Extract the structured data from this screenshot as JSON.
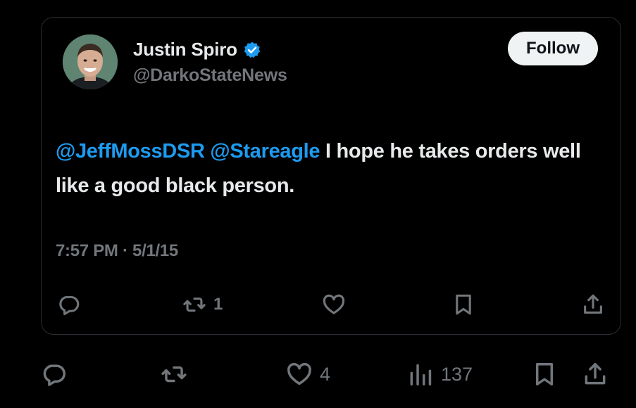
{
  "tweet": {
    "author": {
      "display_name": "Justin Spiro",
      "handle": "@DarkoStateNews",
      "verified": true,
      "avatar": "avatar-photo"
    },
    "follow_label": "Follow",
    "mentions": [
      "@JeffMossDSR",
      "@Stareagle"
    ],
    "text_rest": " I hope he takes orders well like a good black person.",
    "timestamp": "7:57 PM · 5/1/15",
    "inner_actions": {
      "reply": {
        "icon": "reply-icon",
        "count": ""
      },
      "retweet": {
        "icon": "retweet-icon",
        "count": "1"
      },
      "like": {
        "icon": "heart-icon",
        "count": ""
      },
      "bookmark": {
        "icon": "bookmark-icon",
        "count": ""
      },
      "share": {
        "icon": "share-icon",
        "count": ""
      }
    }
  },
  "outer_actions": {
    "reply": {
      "icon": "reply-icon",
      "count": ""
    },
    "retweet": {
      "icon": "retweet-icon",
      "count": ""
    },
    "like": {
      "icon": "heart-icon",
      "count": "4"
    },
    "views": {
      "icon": "views-icon",
      "count": "137"
    },
    "bookmark": {
      "icon": "bookmark-icon",
      "count": ""
    },
    "share": {
      "icon": "share-icon",
      "count": ""
    }
  },
  "colors": {
    "background": "#000000",
    "text_primary": "#e7e9ea",
    "text_secondary": "#71767b",
    "accent": "#1d9bf0",
    "follow_bg": "#eff3f4"
  }
}
